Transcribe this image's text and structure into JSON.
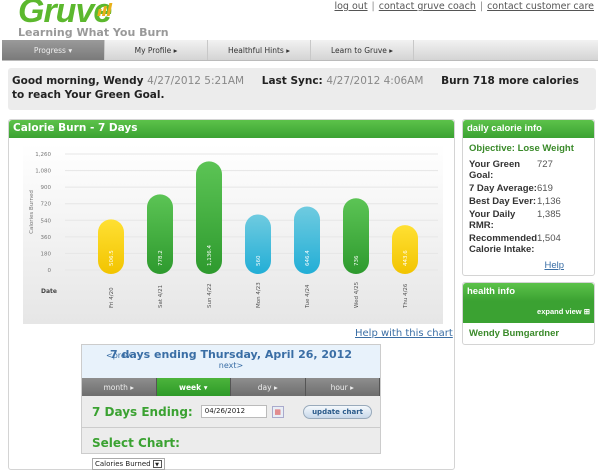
{
  "brand": {
    "logo": "Gruve",
    "tagline": "Learning What You Burn"
  },
  "top_links": [
    "log out",
    "contact gruve coach",
    "contact customer care"
  ],
  "nav": [
    {
      "label": "Progress ▾",
      "active": true
    },
    {
      "label": "My Profile ▸"
    },
    {
      "label": "Healthful Hints ▸"
    },
    {
      "label": "Learn to Gruve ▸"
    }
  ],
  "greeting": {
    "text": "Good morning, Wendy",
    "time": "4/27/2012 5:21AM",
    "sync_label": "Last Sync:",
    "sync_time": "4/27/2012 4:06AM",
    "goal_msg": "Burn 718 more calories to reach Your Green Goal."
  },
  "chart_panel": {
    "title": "Calorie Burn - 7 Days",
    "help_link": "Help with this chart"
  },
  "chart_data": {
    "type": "bar",
    "title": "Calorie Burn - 7 Days",
    "xlabel": "Date",
    "ylabel": "Calories Burned",
    "ylim": [
      0,
      1260
    ],
    "yticks": [
      "0",
      "180",
      "360",
      "540",
      "720",
      "900",
      "1,080",
      "1,260"
    ],
    "categories": [
      "Fri 4/20",
      "Sat 4/21",
      "Sun 4/22",
      "Mon 4/23",
      "Tue 4/24",
      "Wed 4/25",
      "Thu 4/26"
    ],
    "values": [
      506.5,
      778.2,
      1136.4,
      560,
      646.4,
      736,
      443.6
    ],
    "labels": [
      "506.5",
      "778.2",
      "1,136.4",
      "560",
      "646.4",
      "736",
      "443.6"
    ],
    "colors": [
      "yellow",
      "green",
      "green",
      "blue",
      "blue",
      "green",
      "yellow"
    ]
  },
  "controls": {
    "prev": "<prev",
    "next": "next>",
    "range_title": "7 days ending Thursday, April 26, 2012",
    "tabs": [
      {
        "label": "month ▸"
      },
      {
        "label": "week ▾",
        "active": true
      },
      {
        "label": "day ▸"
      },
      {
        "label": "hour ▸"
      }
    ],
    "ending_label": "7 Days Ending:",
    "ending_value": "04/26/2012",
    "update_button": "update chart",
    "select_label": "Select Chart:",
    "select_value": "Calories Burned"
  },
  "daily_info": {
    "title": "daily calorie info",
    "objective": "Objective: Lose Weight",
    "rows": [
      {
        "k": "Your Green Goal:",
        "v": "727"
      },
      {
        "k": "7 Day Average:",
        "v": "619"
      },
      {
        "k": "Best Day Ever:",
        "v": "1,136"
      },
      {
        "k": "Your Daily RMR:",
        "v": "1,385"
      },
      {
        "k": "Recommended Calorie Intake:",
        "v": "1,504"
      }
    ],
    "help": "Help"
  },
  "health_info": {
    "title": "health info",
    "expand": "expand view ⊞",
    "name": "Wendy Bumgardner"
  },
  "colors": {
    "green": "#3ba232",
    "yellow": "#f5cc00",
    "blue": "#3bb5d8"
  }
}
